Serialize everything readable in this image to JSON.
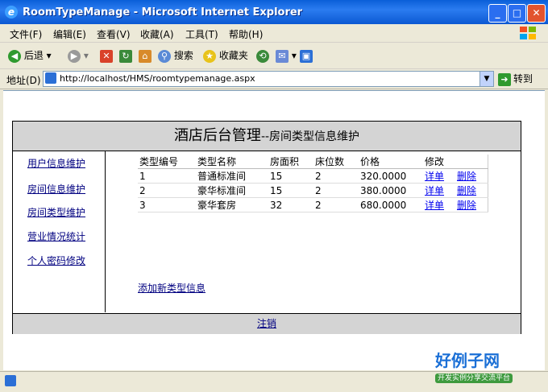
{
  "window": {
    "title": "RoomTypeManage - Microsoft Internet Explorer",
    "minimize": "_",
    "maximize": "□",
    "close": "✕"
  },
  "menu": [
    "文件(F)",
    "编辑(E)",
    "查看(V)",
    "收藏(A)",
    "工具(T)",
    "帮助(H)"
  ],
  "toolbar": {
    "back": "后退",
    "search": "搜索",
    "favorites": "收藏夹"
  },
  "address": {
    "label": "地址(D)",
    "url": "http://localhost/HMS/roomtypemanage.aspx",
    "go": "转到"
  },
  "page": {
    "header_main": "酒店后台管理",
    "header_sub": "--房间类型信息维护",
    "sidebar": [
      "用户信息维护",
      "房间信息维护",
      "房间类型维护",
      "营业情况统计",
      "个人密码修改"
    ],
    "columns": [
      "类型编号",
      "类型名称",
      "房面积",
      "床位数",
      "价格",
      "修改",
      ""
    ],
    "rows": [
      {
        "id": "1",
        "name": "普通标准间",
        "area": "15",
        "beds": "2",
        "price": "320.0000",
        "detail": "详单",
        "delete": "删除"
      },
      {
        "id": "2",
        "name": "豪华标准间",
        "area": "15",
        "beds": "2",
        "price": "380.0000",
        "detail": "详单",
        "delete": "删除"
      },
      {
        "id": "3",
        "name": "豪华套房",
        "area": "32",
        "beds": "2",
        "price": "680.0000",
        "detail": "详单",
        "delete": "删除"
      }
    ],
    "add_link": "添加新类型信息",
    "logout": "注销"
  },
  "brand": {
    "name": "好例子网",
    "slogan": "开发实例分享交流平台"
  }
}
